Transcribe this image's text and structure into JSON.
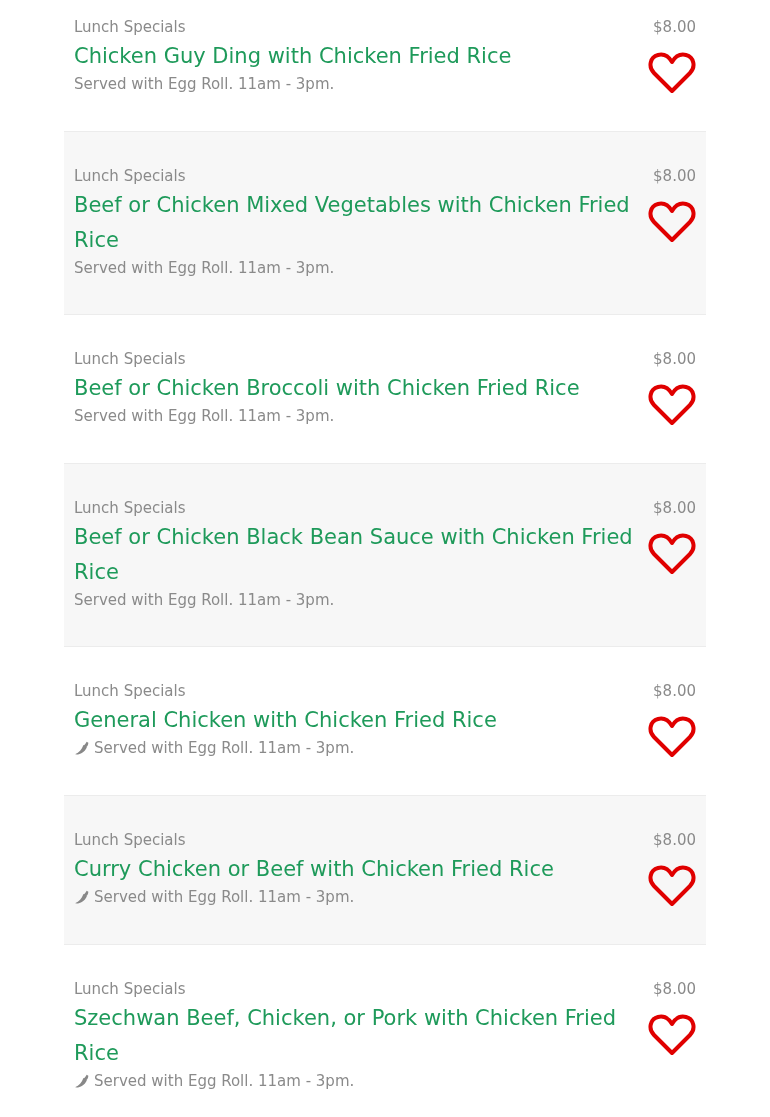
{
  "menu_items": [
    {
      "category": "Lunch Specials",
      "name": "Chicken Guy Ding with Chicken Fried Rice",
      "description": "Served with Egg Roll. 11am - 3pm.",
      "price": "$8.00",
      "spicy": false,
      "favorited": false
    },
    {
      "category": "Lunch Specials",
      "name": "Beef or Chicken Mixed Vegetables with Chicken Fried Rice",
      "description": "Served with Egg Roll. 11am - 3pm.",
      "price": "$8.00",
      "spicy": false,
      "favorited": false
    },
    {
      "category": "Lunch Specials",
      "name": "Beef or Chicken Broccoli with Chicken Fried Rice",
      "description": "Served with Egg Roll. 11am - 3pm.",
      "price": "$8.00",
      "spicy": false,
      "favorited": false
    },
    {
      "category": "Lunch Specials",
      "name": "Beef or Chicken Black Bean Sauce with Chicken Fried Rice",
      "description": "Served with Egg Roll. 11am - 3pm.",
      "price": "$8.00",
      "spicy": false,
      "favorited": false
    },
    {
      "category": "Lunch Specials",
      "name": "General Chicken with Chicken Fried Rice",
      "description": "Served with Egg Roll. 11am - 3pm.",
      "price": "$8.00",
      "spicy": true,
      "favorited": false
    },
    {
      "category": "Lunch Specials",
      "name": "Curry Chicken or Beef with Chicken Fried Rice",
      "description": "Served with Egg Roll. 11am - 3pm.",
      "price": "$8.00",
      "spicy": true,
      "favorited": false
    },
    {
      "category": "Lunch Specials",
      "name": "Szechwan Beef, Chicken, or Pork with Chicken Fried Rice",
      "description": "Served with Egg Roll. 11am - 3pm.",
      "price": "$8.00",
      "spicy": true,
      "favorited": false
    }
  ]
}
